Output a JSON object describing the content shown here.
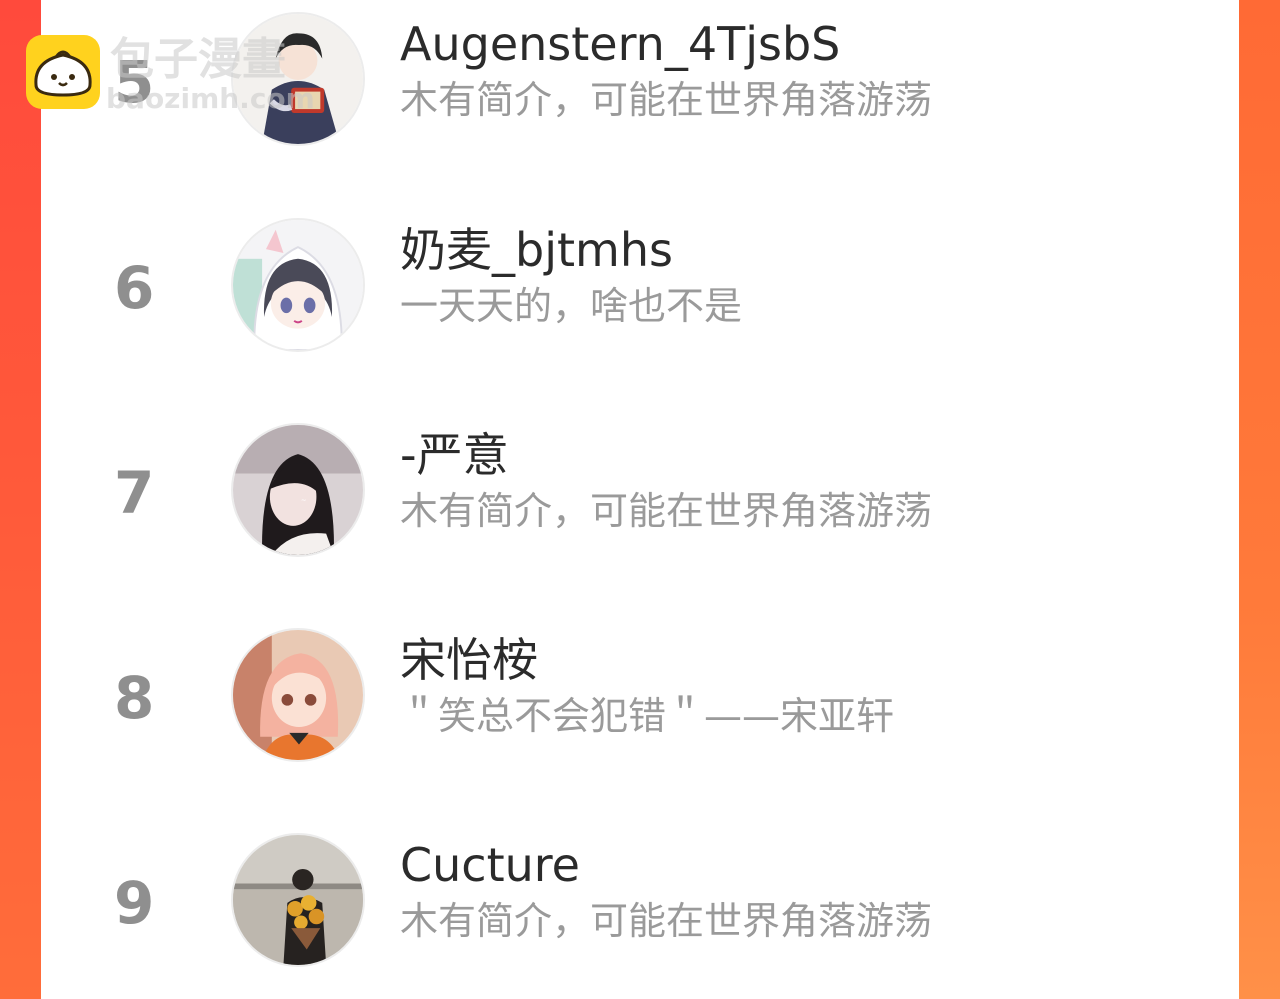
{
  "watermark": {
    "brand": "包子漫畫",
    "domain": "baozimh.com"
  },
  "colors": {
    "background_left": "#ff4a3c",
    "background_right": "#ff7a3a",
    "rank": "#8f8f8f",
    "name": "#2b2b2b",
    "bio": "#9a9a9a",
    "logo": "#ffd21e"
  },
  "users": [
    {
      "rank": "5",
      "name": "Augenstern_4TjsbS",
      "bio": "木有简介，可能在世界角落游荡",
      "avatar": "avatar-anime-boy-with-book"
    },
    {
      "rank": "6",
      "name": "奶麦_bjtmhs",
      "bio": "一天天的，啥也不是",
      "avatar": "avatar-anime-girl-hood"
    },
    {
      "rank": "7",
      "name": "-严意",
      "bio": "木有简介，可能在世界角落游荡",
      "avatar": "avatar-photo-girl"
    },
    {
      "rank": "8",
      "name": "宋怡桉",
      "bio": "＂笑总不会犯错＂——宋亚轩",
      "avatar": "avatar-anime-girl-orange"
    },
    {
      "rank": "9",
      "name": "Cucture",
      "bio": "木有简介，可能在世界角落游荡",
      "avatar": "avatar-photo-sunflowers"
    }
  ]
}
